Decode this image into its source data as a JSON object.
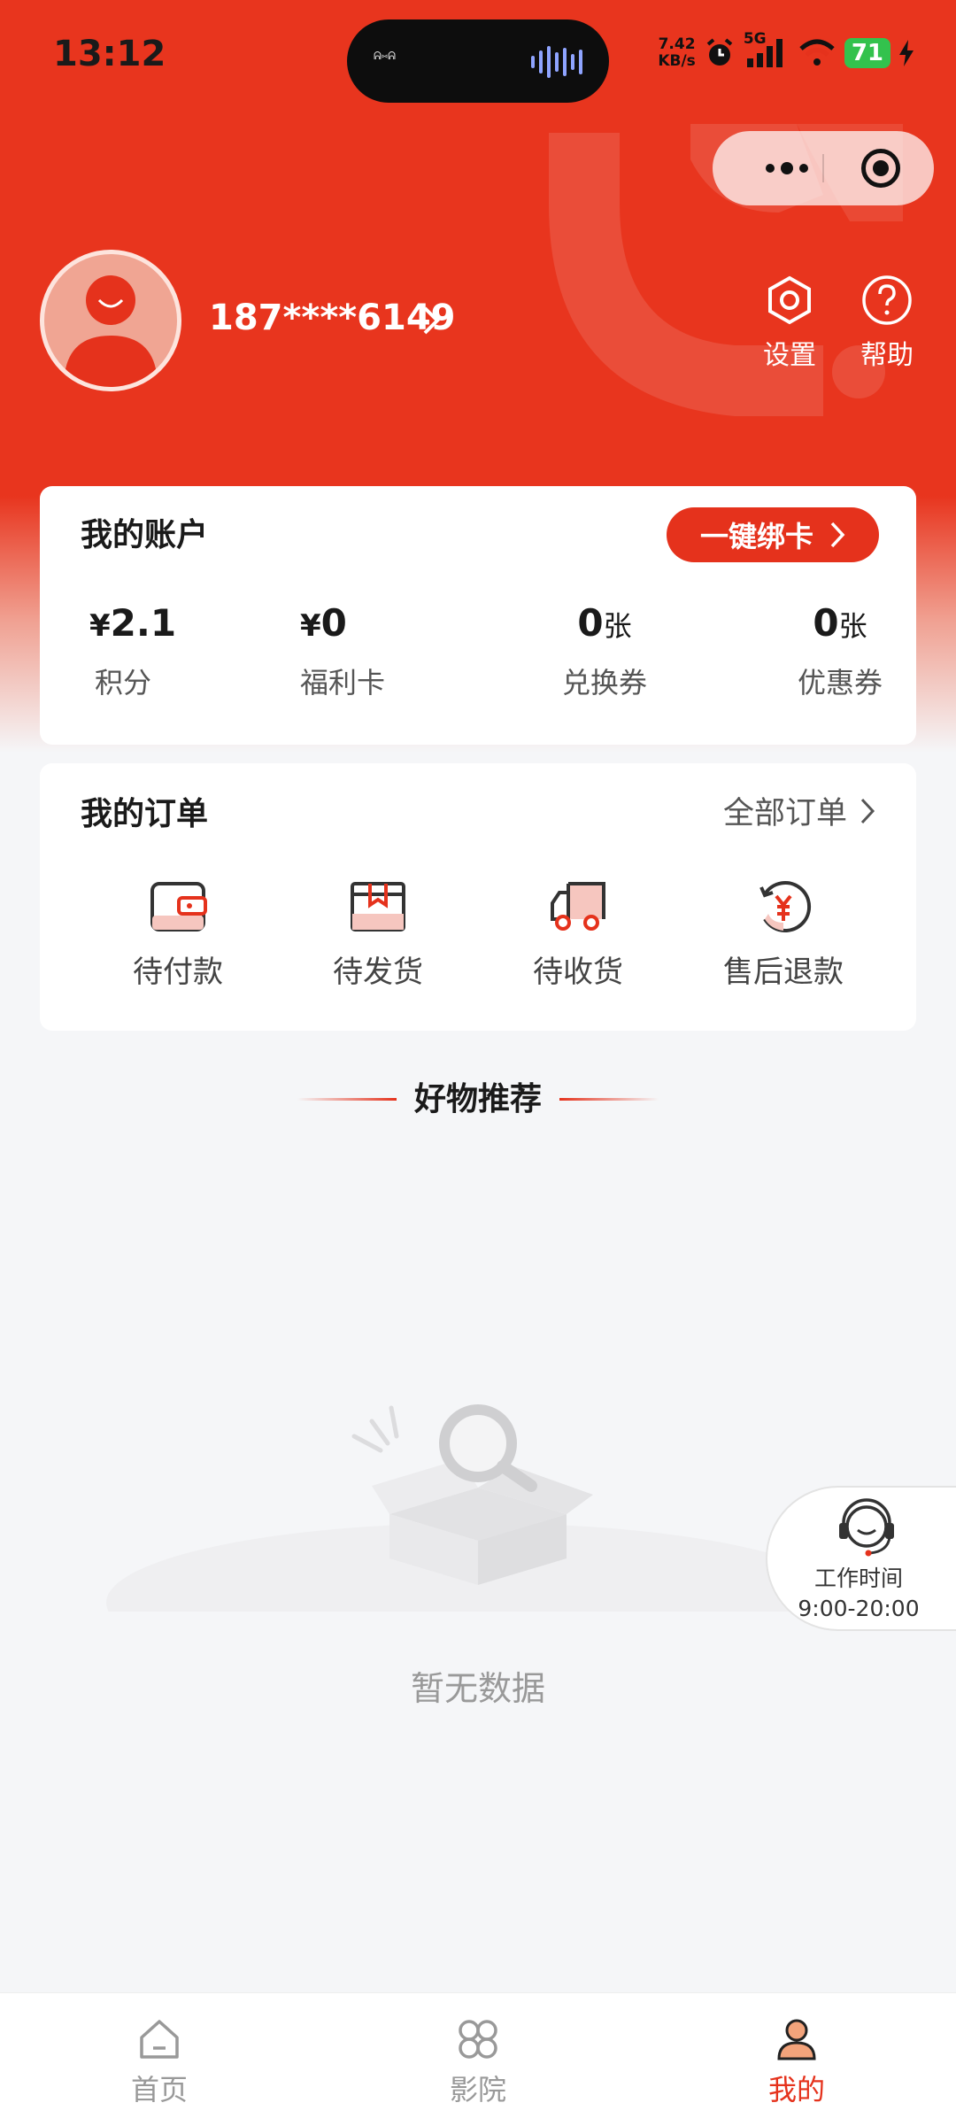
{
  "status_bar": {
    "time": "13:12",
    "net_speed_value": "7.42",
    "net_speed_unit": "KB/s",
    "network": "5G",
    "battery": "71",
    "island_text": "ᕱ⑅ᕱ"
  },
  "profile": {
    "phone": "187****6149",
    "settings_label": "设置",
    "help_label": "帮助"
  },
  "account": {
    "title": "我的账户",
    "bind_card_label": "一键绑卡",
    "stats": [
      {
        "currency": "¥",
        "value": "2.1",
        "unit": "",
        "label": "积分"
      },
      {
        "currency": "¥",
        "value": "0",
        "unit": "",
        "label": "福利卡"
      },
      {
        "currency": "",
        "value": "0",
        "unit": "张",
        "label": "兑换券"
      },
      {
        "currency": "",
        "value": "0",
        "unit": "张",
        "label": "优惠券"
      }
    ]
  },
  "orders": {
    "title": "我的订单",
    "all_orders_label": "全部订单",
    "items": [
      {
        "label": "待付款",
        "icon": "wallet-icon"
      },
      {
        "label": "待发货",
        "icon": "package-icon"
      },
      {
        "label": "待收货",
        "icon": "truck-icon"
      },
      {
        "label": "售后退款",
        "icon": "refund-icon"
      }
    ]
  },
  "recommend": {
    "title": "好物推荐",
    "empty_text": "暂无数据"
  },
  "service": {
    "line1": "工作时间",
    "line2": "9:00-20:00"
  },
  "tabbar": [
    {
      "label": "首页",
      "icon": "home-icon",
      "active": false
    },
    {
      "label": "影院",
      "icon": "cinema-icon",
      "active": false
    },
    {
      "label": "我的",
      "icon": "profile-icon",
      "active": true
    }
  ],
  "colors": {
    "brand_red": "#e5321c",
    "hero_red": "#e8351e",
    "page_bg": "#f5f6f8"
  }
}
